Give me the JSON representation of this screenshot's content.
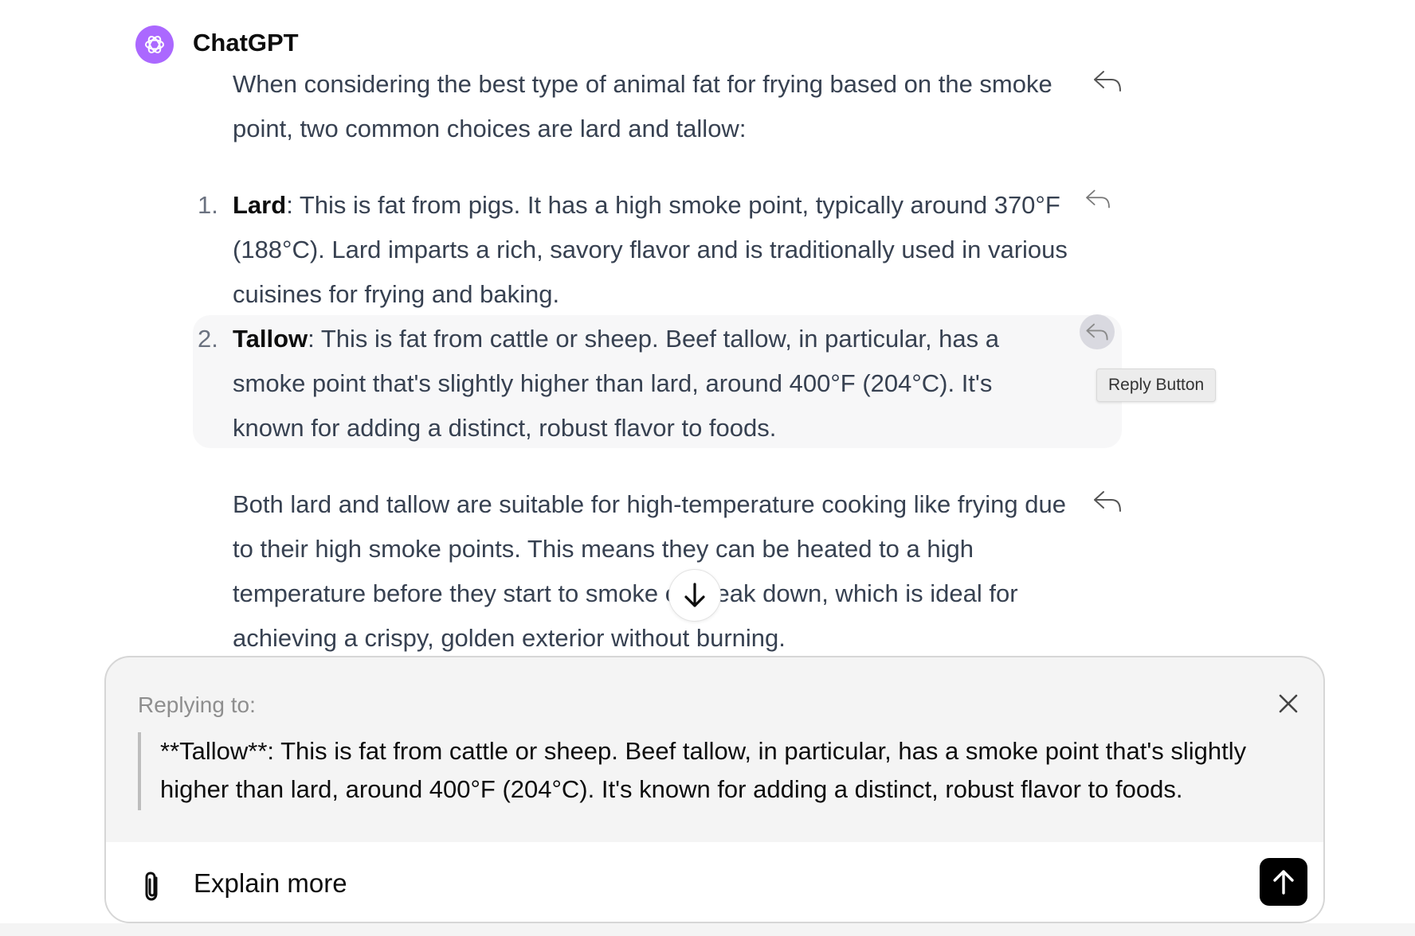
{
  "message": {
    "author": "ChatGPT",
    "intro": "When considering the best type of animal fat for frying based on the smoke point, two common choices are lard and tallow:",
    "items": [
      {
        "number": "1.",
        "term": "Lard",
        "text": ": This is fat from pigs. It has a high smoke point, typically around 370°F (188°C). Lard imparts a rich, savory flavor and is traditionally used in various cuisines for frying and baking."
      },
      {
        "number": "2.",
        "term": "Tallow",
        "text": ": This is fat from cattle or sheep. Beef tallow, in particular, has a smoke point that's slightly higher than lard, around 400°F (204°C). It's known for adding a distinct, robust flavor to foods."
      }
    ],
    "closing": "Both lard and tallow are suitable for high-temperature cooking like frying due to their high smoke points. This means they can be heated to a high temperature before they start to smoke or break down, which is ideal for achieving a crispy, golden exterior without burning."
  },
  "tooltip": "Reply Button",
  "icons": {
    "reply": "reply-icon",
    "scroll": "arrow-down-icon",
    "close": "close-icon",
    "attach": "paperclip-icon",
    "send": "arrow-up-icon"
  },
  "composer": {
    "replying_label": "Replying to:",
    "quote": "**Tallow**: This is fat from cattle or sheep. Beef tallow, in particular, has a smoke point that's slightly higher than lard, around 400°F (204°C). It's known for adding a distinct, robust flavor to foods.",
    "input_value": "Explain more"
  },
  "colors": {
    "avatar": "#ab68ff",
    "text": "#374151",
    "highlight": "#f7f7f8",
    "send_button": "#000000"
  }
}
